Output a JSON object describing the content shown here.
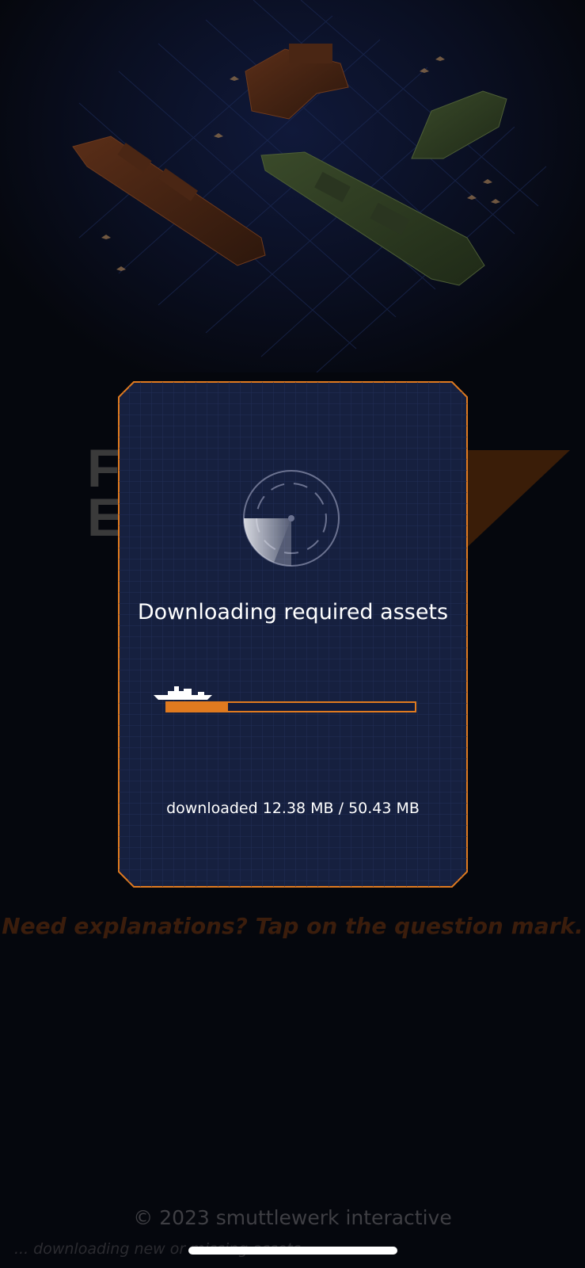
{
  "background": {
    "hint_text": "Need explanations? Tap on the question mark.",
    "copyright": "© 2023 smuttlewerk interactive",
    "status_line": "... downloading new or missing assets",
    "logo_letters": "F\nE",
    "colors": {
      "page_bg": "#05070d",
      "accent": "#e07a1f",
      "hint": "#3b1d0c"
    }
  },
  "modal": {
    "title": "Downloading required assets",
    "progress": {
      "downloaded_mb": 12.38,
      "total_mb": 50.43,
      "fraction": 0.245,
      "text": "downloaded 12.38 MB / 50.43 MB"
    },
    "icons": {
      "spinner": "radar-icon",
      "progress_marker": "ship-icon"
    },
    "colors": {
      "panel": "#16203f",
      "border": "#e07a1f",
      "text": "#ffffff"
    }
  }
}
